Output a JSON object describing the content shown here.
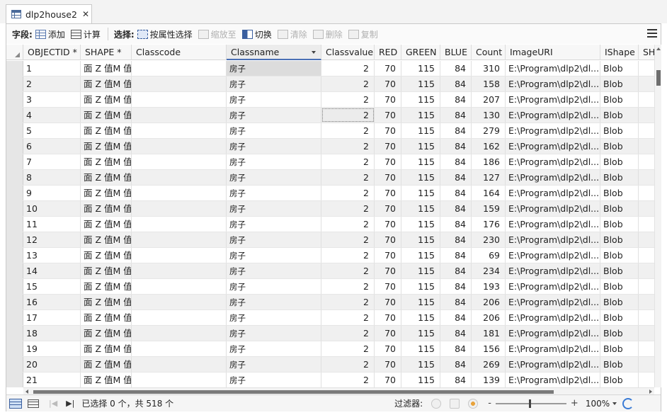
{
  "tab": {
    "title": "dlp2house2",
    "close": "✕"
  },
  "toolbar": {
    "fields_label": "字段:",
    "add": "添加",
    "calculate": "计算",
    "selection_label": "选择:",
    "select_by_attr": "按属性选择",
    "zoom_to": "缩放至",
    "switch": "切换",
    "clear": "清除",
    "delete": "删除",
    "copy": "复制"
  },
  "columns": [
    "OBJECTID *",
    "SHAPE *",
    "Classcode",
    "Classname",
    "Classvalue",
    "RED",
    "GREEN",
    "BLUE",
    "Count",
    "ImageURI",
    "IShape",
    "SH"
  ],
  "row_defaults": {
    "shape": "面 Z 值M 值",
    "classcode": "",
    "classname": "房子",
    "classvalue": "2",
    "red": "70",
    "green": "115",
    "blue": "84",
    "imageuri": "E:\\Program\\dlp2\\dl...",
    "ishape": "Blob"
  },
  "rows": [
    {
      "oid": "1",
      "count": "310"
    },
    {
      "oid": "2",
      "count": "158"
    },
    {
      "oid": "3",
      "count": "207"
    },
    {
      "oid": "4",
      "count": "130"
    },
    {
      "oid": "5",
      "count": "279"
    },
    {
      "oid": "6",
      "count": "162"
    },
    {
      "oid": "7",
      "count": "186"
    },
    {
      "oid": "8",
      "count": "127"
    },
    {
      "oid": "9",
      "count": "164"
    },
    {
      "oid": "10",
      "count": "159"
    },
    {
      "oid": "11",
      "count": "176"
    },
    {
      "oid": "12",
      "count": "230"
    },
    {
      "oid": "13",
      "count": "69"
    },
    {
      "oid": "14",
      "count": "234"
    },
    {
      "oid": "15",
      "count": "193"
    },
    {
      "oid": "16",
      "count": "206"
    },
    {
      "oid": "17",
      "count": "206"
    },
    {
      "oid": "18",
      "count": "181"
    },
    {
      "oid": "19",
      "count": "156"
    },
    {
      "oid": "20",
      "count": "269"
    },
    {
      "oid": "21",
      "count": "139"
    }
  ],
  "status": {
    "selection_count": "已选择 0 个，共 518 个",
    "filter_label": "过滤器:",
    "zoom_minus": "-",
    "zoom_plus": "+",
    "zoom": "100%"
  }
}
